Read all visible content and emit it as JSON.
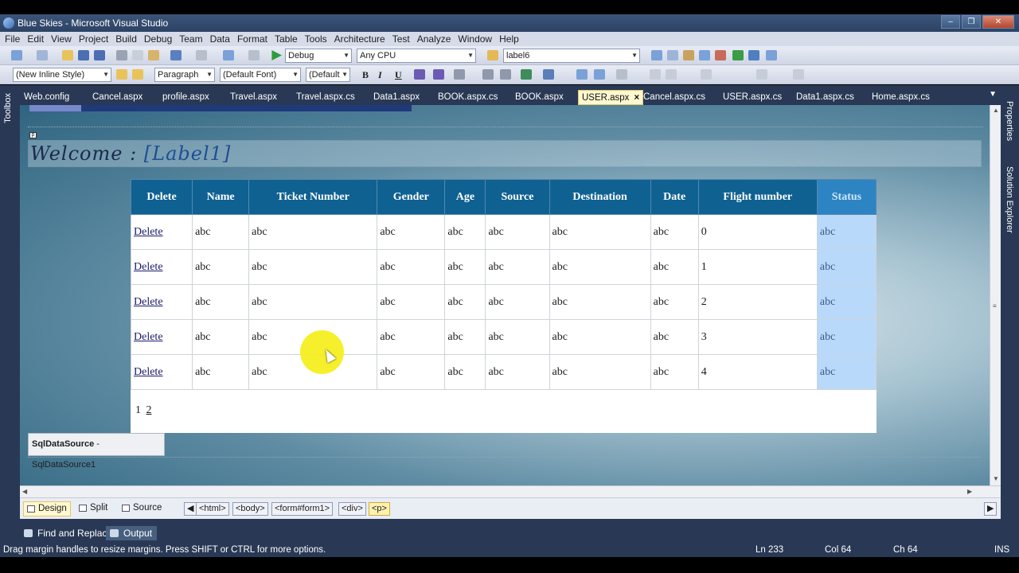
{
  "window": {
    "title": "Blue Skies - Microsoft Visual Studio"
  },
  "menu": [
    "File",
    "Edit",
    "View",
    "Project",
    "Build",
    "Debug",
    "Team",
    "Data",
    "Format",
    "Table",
    "Tools",
    "Architecture",
    "Test",
    "Analyze",
    "Window",
    "Help"
  ],
  "toolbar1": {
    "config": "Debug",
    "platform": "Any CPU",
    "find_target": "label6"
  },
  "toolbar2": {
    "style": "(New Inline Style)",
    "block": "Paragraph",
    "font": "(Default Font)",
    "size": "(Default"
  },
  "doc_tabs": [
    "Web.config",
    "Cancel.aspx",
    "profile.aspx",
    "Travel.aspx",
    "Travel.aspx.cs",
    "Data1.aspx",
    "BOOK.aspx.cs",
    "BOOK.aspx",
    "USER.aspx",
    "Cancel.aspx.cs",
    "USER.aspx.cs",
    "Data1.aspx.cs",
    "Home.aspx.cs"
  ],
  "active_tab_close": "×",
  "side_tabs": {
    "left": "Toolbox",
    "right_properties": "Properties",
    "right_solution": "Solution Explorer"
  },
  "design": {
    "welcome": "Welcome :",
    "label": "[Label1]",
    "grid": {
      "headers": [
        "Delete",
        "Name",
        "Ticket Number",
        "Gender",
        "Age",
        "Source",
        "Destination",
        "Date",
        "Flight number",
        "Status"
      ],
      "rows": [
        [
          "Delete",
          "abc",
          "abc",
          "abc",
          "abc",
          "abc",
          "abc",
          "abc",
          "0",
          "abc"
        ],
        [
          "Delete",
          "abc",
          "abc",
          "abc",
          "abc",
          "abc",
          "abc",
          "abc",
          "1",
          "abc"
        ],
        [
          "Delete",
          "abc",
          "abc",
          "abc",
          "abc",
          "abc",
          "abc",
          "abc",
          "2",
          "abc"
        ],
        [
          "Delete",
          "abc",
          "abc",
          "abc",
          "abc",
          "abc",
          "abc",
          "abc",
          "3",
          "abc"
        ],
        [
          "Delete",
          "abc",
          "abc",
          "abc",
          "abc",
          "abc",
          "abc",
          "abc",
          "4",
          "abc"
        ]
      ],
      "pager": {
        "page1": "1",
        "page2": "2"
      }
    },
    "sqldatasource": {
      "type": "SqlDataSource",
      "name": " - SqlDataSource1"
    }
  },
  "view_buttons": {
    "design": "Design",
    "split": "Split",
    "source": "Source"
  },
  "breadcrumbs": [
    "<html>",
    "<body>",
    "<form#form1>",
    "<div>",
    "<p>"
  ],
  "bottom_tabs": {
    "find": "Find and Replace",
    "output": "Output"
  },
  "status": {
    "message": "Drag margin handles to resize margins. Press SHIFT or CTRL for more options.",
    "ln": "Ln 233",
    "col": "Col 64",
    "ch": "Ch 64",
    "mode": "INS"
  }
}
